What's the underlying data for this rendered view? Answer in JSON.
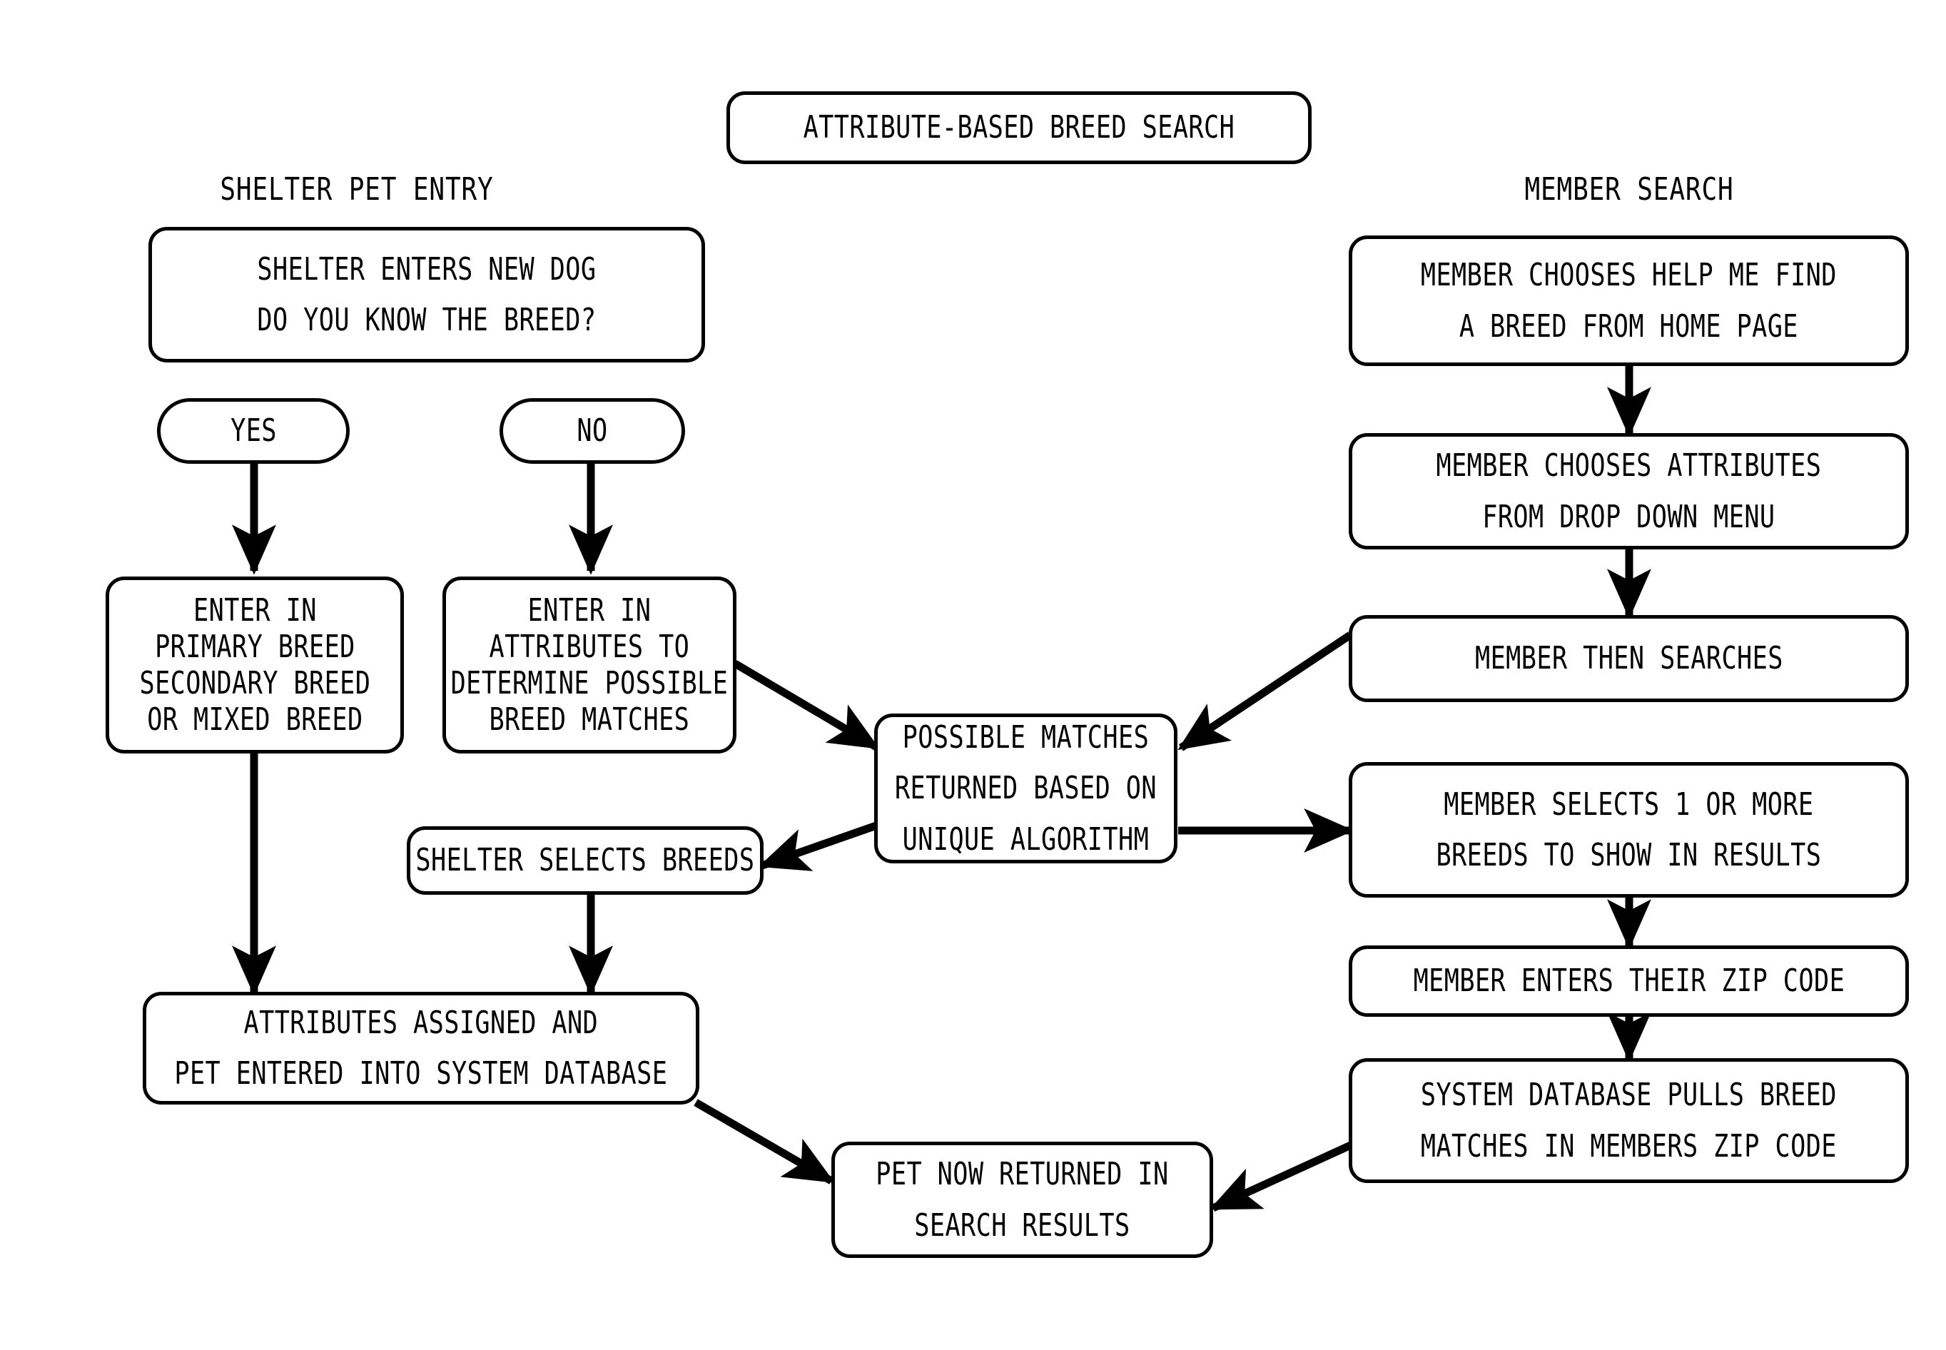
{
  "diagram": {
    "title": "ATTRIBUTE-BASED BREED SEARCH",
    "sections": {
      "left": "SHELTER PET ENTRY",
      "right": "MEMBER SEARCH"
    },
    "nodes": {
      "title_box": "ATTRIBUTE-BASED BREED SEARCH",
      "shelter_enters": {
        "line1": "SHELTER ENTERS NEW DOG",
        "line2": "DO YOU KNOW THE BREED?"
      },
      "yes": "YES",
      "no": "NO",
      "enter_breed": {
        "line1": "ENTER IN",
        "line2": "PRIMARY BREED",
        "line3": "SECONDARY BREED",
        "line4": "OR MIXED BREED"
      },
      "enter_attributes": {
        "line1": "ENTER IN",
        "line2": "ATTRIBUTES TO",
        "line3": "DETERMINE POSSIBLE",
        "line4": "BREED MATCHES"
      },
      "possible_matches": {
        "line1": "POSSIBLE MATCHES",
        "line2": "RETURNED BASED ON",
        "line3": "UNIQUE ALGORITHM"
      },
      "shelter_selects": "SHELTER SELECTS BREEDS",
      "attributes_assigned": {
        "line1": "ATTRIBUTES ASSIGNED AND",
        "line2": "PET ENTERED INTO SYSTEM DATABASE"
      },
      "pet_returned": {
        "line1": "PET NOW RETURNED IN",
        "line2": "SEARCH RESULTS"
      },
      "member_chooses_help": {
        "line1": "MEMBER CHOOSES HELP ME FIND",
        "line2": "A BREED FROM HOME PAGE"
      },
      "member_chooses_attributes": {
        "line1": "MEMBER CHOOSES ATTRIBUTES",
        "line2": "FROM DROP DOWN MENU"
      },
      "member_searches": "MEMBER THEN SEARCHES",
      "member_selects": {
        "line1": "MEMBER SELECTS 1 OR MORE",
        "line2": "BREEDS TO SHOW IN RESULTS"
      },
      "member_zip": "MEMBER ENTERS THEIR ZIP CODE",
      "system_pulls": {
        "line1": "SYSTEM DATABASE PULLS BREED",
        "line2": "MATCHES IN MEMBERS ZIP CODE"
      }
    },
    "colors": {
      "stroke": "#000000",
      "fill": "#ffffff",
      "text": "#000000"
    }
  }
}
